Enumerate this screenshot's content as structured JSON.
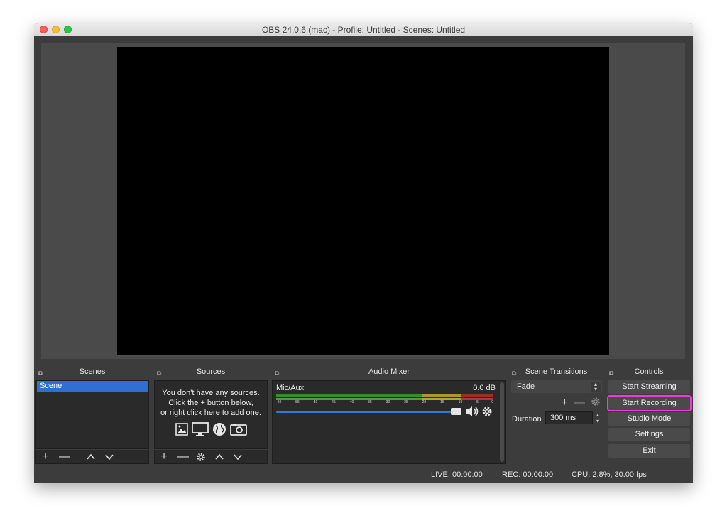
{
  "window": {
    "title": "OBS 24.0.6 (mac) - Profile: Untitled - Scenes: Untitled"
  },
  "docks": {
    "scenes": {
      "title": "Scenes",
      "items": [
        "Scene"
      ]
    },
    "sources": {
      "title": "Sources",
      "empty_message": [
        "You don't have any sources.",
        "Click the + button below,",
        "or right click here to add one."
      ]
    },
    "audio_mixer": {
      "title": "Audio Mixer",
      "channel": "Mic/Aux",
      "level": "0.0 dB",
      "ticks": [
        "-60",
        "-55",
        "-50",
        "-45",
        "-40",
        "-35",
        "-30",
        "-25",
        "-20",
        "-15",
        "-10",
        "-5",
        "0"
      ],
      "volume_fraction": 0.8
    },
    "transitions": {
      "title": "Scene Transitions",
      "selected": "Fade",
      "duration_label": "Duration",
      "duration_value": "300 ms"
    },
    "controls": {
      "title": "Controls",
      "start_streaming": "Start Streaming",
      "start_recording": "Start Recording",
      "studio_mode": "Studio Mode",
      "settings": "Settings",
      "exit": "Exit"
    }
  },
  "status": {
    "live": "LIVE: 00:00:00",
    "rec": "REC: 00:00:00",
    "cpu": "CPU: 2.8%, 30.00 fps"
  },
  "colors": {
    "accent": "#2f6fd1",
    "highlight": "#ee3ad9",
    "background": "#3c3c3c"
  }
}
